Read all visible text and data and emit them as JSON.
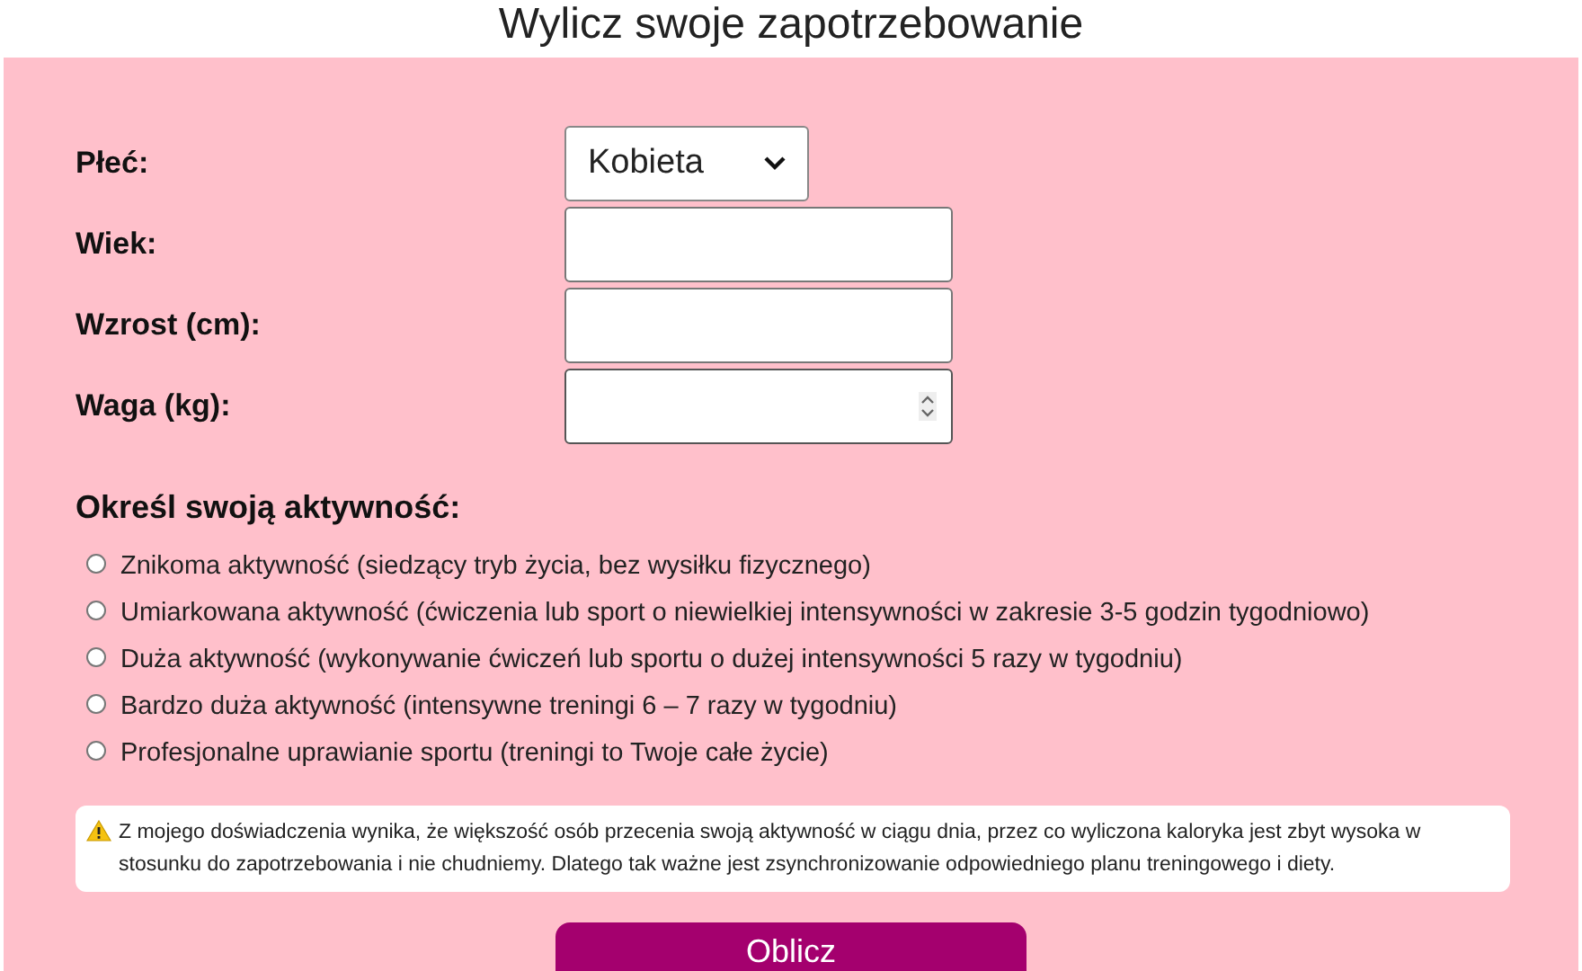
{
  "title": "Wylicz swoje zapotrzebowanie",
  "fields": [
    {
      "label": "Płeć:",
      "kind": "select",
      "value": "Kobieta"
    },
    {
      "label": "Wiek:",
      "kind": "text"
    },
    {
      "label": "Wzrost (cm):",
      "kind": "text"
    },
    {
      "label": "Waga (kg):",
      "kind": "number"
    }
  ],
  "activity": {
    "heading": "Określ swoją aktywność:",
    "options": [
      {
        "label": "Znikoma aktywność (siedzący tryb życia, bez wysiłku fizycznego)",
        "selected": false
      },
      {
        "label": "Umiarkowana aktywność (ćwiczenia lub sport o niewielkiej intensywności w zakresie 3-5 godzin tygodniowo)",
        "selected": false
      },
      {
        "label": "Duża aktywność (wykonywanie ćwiczeń lub sportu o dużej intensywności 5 razy w tygodniu)",
        "selected": false
      },
      {
        "label": "Bardzo duża aktywność (intensywne treningi 6 – 7 razy w tygodniu)",
        "selected": false
      },
      {
        "label": "Profesjonalne uprawianie sportu (treningi to Twoje całe życie)",
        "selected": false
      }
    ]
  },
  "note": "Z mojego doświadczenia wynika, że większość osób przecenia swoją aktywność w ciągu dnia, przez co wyliczona kaloryka jest zbyt wysoka w stosunku do zapotrzebowania i nie chudniemy. Dlatego tak ważne jest zsynchronizowanie odpowiedniego planu treningowego i diety.",
  "button": "Oblicz"
}
